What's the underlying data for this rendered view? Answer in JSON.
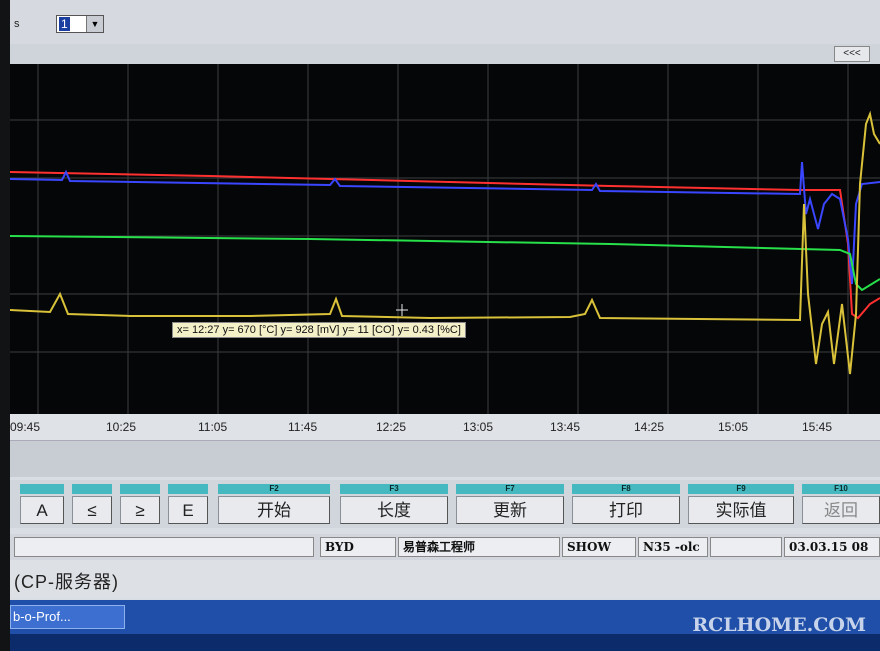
{
  "topbar": {
    "label": "s",
    "select_value": "1",
    "select_arrow": "▼",
    "collapse_label": "<<<"
  },
  "cursor_readout": "x= 12:27  y= 670 [°C]  y= 928 [mV]  y= 11 [CO]  y= 0.43 [%C]",
  "x_ticks": [
    "09:45",
    "10:25",
    "11:05",
    "11:45",
    "12:25",
    "13:05",
    "13:45",
    "14:25",
    "15:05",
    "15:45"
  ],
  "colors": {
    "red": "#ff3030",
    "blue": "#3a46ff",
    "green": "#27e04a",
    "yellow": "#d9c23a",
    "grid": "#3a3d42",
    "teal": "#46b8c0"
  },
  "fkeys": [
    {
      "cap": "",
      "label": "A"
    },
    {
      "cap": "",
      "label": "≤"
    },
    {
      "cap": "",
      "label": "≥"
    },
    {
      "cap": "",
      "label": "E"
    },
    {
      "cap": "F2",
      "label": "开始"
    },
    {
      "cap": "F3",
      "label": "长度"
    },
    {
      "cap": "F7",
      "label": "更新"
    },
    {
      "cap": "F8",
      "label": "打印"
    },
    {
      "cap": "F9",
      "label": "实际值"
    },
    {
      "cap": "F10",
      "label": "返回"
    }
  ],
  "status": {
    "byd": "BYD",
    "engineer": "易普森工程师",
    "mode": "SHOW",
    "n35": "N35 -olc",
    "datetime": "03.03.15 08"
  },
  "server_label": "(CP-服务器)",
  "taskbar": {
    "item": "b-o-Prof..."
  },
  "watermark": "RCLHOME.COM"
}
